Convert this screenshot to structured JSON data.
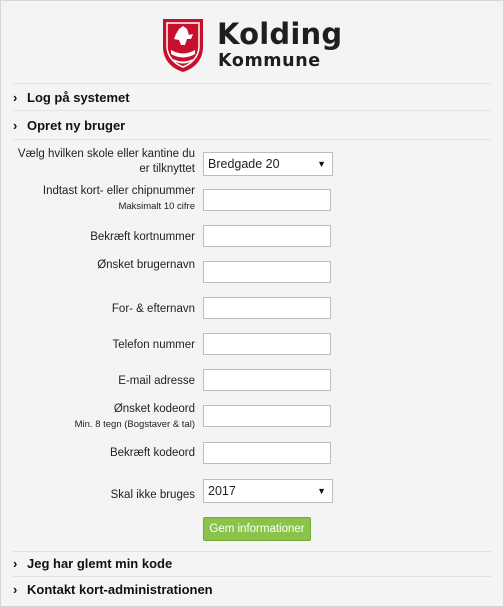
{
  "logo": {
    "line1": "Kolding",
    "line2": "Kommune"
  },
  "sections": {
    "login": "Log på systemet",
    "create": "Opret ny bruger",
    "forgot": "Jeg har glemt min kode",
    "contact": "Kontakt kort-administrationen"
  },
  "form": {
    "school_label": "Vælg hvilken skole eller kantine du er tilknyttet",
    "school_value": "Bredgade 20",
    "card_label": "Indtast kort- eller chipnummer",
    "card_sub": "Maksimalt 10 cifre",
    "confirm_card_label": "Bekræft kortnummer",
    "username_label": "Ønsket brugernavn",
    "name_label": "For- & efternavn",
    "phone_label": "Telefon nummer",
    "email_label": "E-mail adresse",
    "password_label": "Ønsket kodeord",
    "password_sub": "Min. 8 tegn (Bogstaver & tal)",
    "confirm_password_label": "Bekræft kodeord",
    "expire_label": "Skal ikke bruges",
    "expire_value": "2017",
    "save_button": "Gem informationer"
  },
  "colors": {
    "accent_button": "#8bc34a",
    "logo_red": "#c8102e"
  }
}
